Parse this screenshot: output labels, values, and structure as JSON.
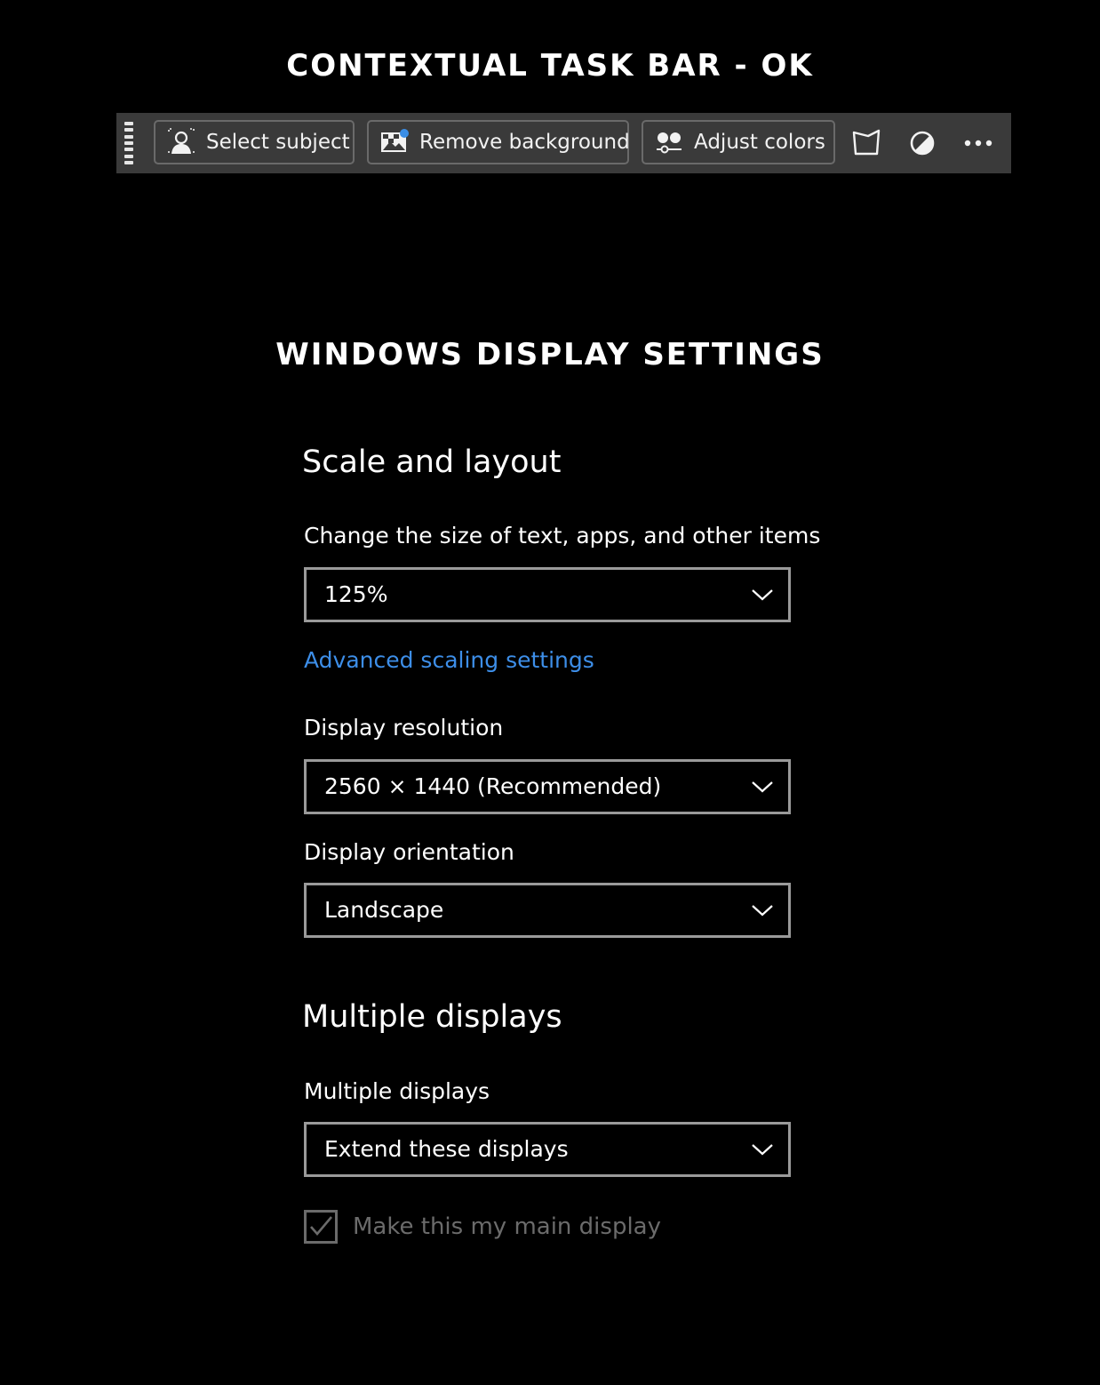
{
  "headings": {
    "taskbar": "CONTEXTUAL TASK BAR - OK",
    "display": "WINDOWS DISPLAY SETTINGS"
  },
  "taskbar": {
    "buttons": [
      {
        "label": "Select subject",
        "icon": "person-select-icon"
      },
      {
        "label": "Remove background",
        "icon": "image-remove-background-icon"
      },
      {
        "label": "Adjust colors",
        "icon": "adjust-colors-icon"
      }
    ],
    "icon_buttons": [
      "transform-icon",
      "contrast-icon",
      "more-icon"
    ],
    "colors": {
      "bar": "#3a3a3a",
      "button_border": "#6a6a6a",
      "accent": "#3a8ee6"
    }
  },
  "settings": {
    "scale": {
      "title": "Scale and layout",
      "size_label": "Change the size of text, apps, and other items",
      "size_value": "125%",
      "advanced_link": "Advanced scaling settings",
      "resolution_label": "Display resolution",
      "resolution_value": "2560 × 1440 (Recommended)",
      "orientation_label": "Display orientation",
      "orientation_value": "Landscape"
    },
    "multiple": {
      "title": "Multiple displays",
      "label": "Multiple displays",
      "value": "Extend these displays",
      "main_display_checkbox": "Make this my main display",
      "main_display_checked": true
    },
    "colors": {
      "link": "#3d8ee8",
      "dropdown_border": "#9a9a9a",
      "disabled": "#6b6b6b"
    }
  }
}
